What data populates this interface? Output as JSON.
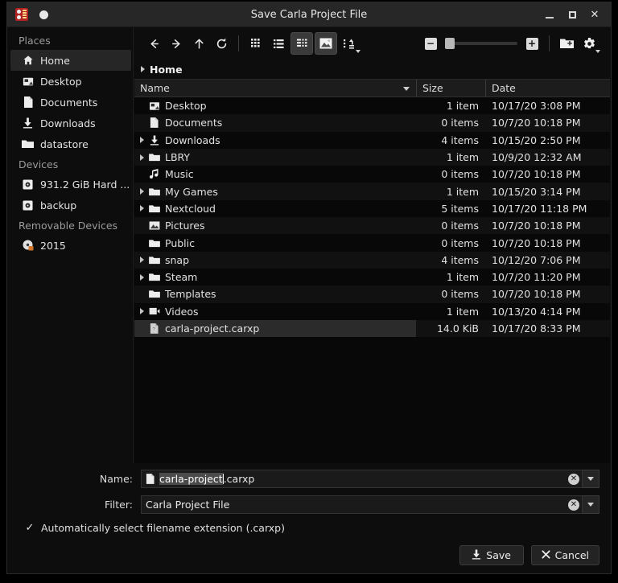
{
  "window": {
    "title": "Save Carla Project File",
    "app_icon": "carla-logo-icon",
    "minimize_label": "",
    "maximize_label": "",
    "close_label": "✕"
  },
  "sidebar": {
    "sections": [
      {
        "heading": "Places",
        "items": [
          {
            "label": "Home",
            "icon": "home-icon",
            "selected": true
          },
          {
            "label": "Desktop",
            "icon": "desktop-icon",
            "selected": false
          },
          {
            "label": "Documents",
            "icon": "document-icon",
            "selected": false
          },
          {
            "label": "Downloads",
            "icon": "download-icon",
            "selected": false
          },
          {
            "label": "datastore",
            "icon": "folder-icon",
            "selected": false
          }
        ]
      },
      {
        "heading": "Devices",
        "items": [
          {
            "label": "931.2 GiB Hard ...",
            "icon": "harddisk-icon",
            "selected": false
          },
          {
            "label": "backup",
            "icon": "harddisk-icon",
            "selected": false
          }
        ]
      },
      {
        "heading": "Removable Devices",
        "items": [
          {
            "label": "2015",
            "icon": "optical-disc-icon",
            "selected": false
          }
        ]
      }
    ]
  },
  "toolbar": {
    "back": "back-icon",
    "forward": "forward-icon",
    "up": "up-icon",
    "reload": "reload-icon",
    "icon_view": "icon-view-icon",
    "list_view": "list-view-icon",
    "detail_view": "detail-view-icon",
    "preview": "preview-icon",
    "sort": "sort-icon",
    "zoom_out": "zoom-out-icon",
    "zoom_in": "zoom-in-icon",
    "new_folder": "new-folder-icon",
    "options": "gear-icon"
  },
  "breadcrumb": {
    "path": "Home"
  },
  "filelist": {
    "columns": [
      "Name",
      "Size",
      "Date"
    ],
    "sort_column": "Name",
    "rows": [
      {
        "name": "Desktop",
        "size": "1 item",
        "date": "10/17/20 3:08 PM",
        "icon": "desktop-icon",
        "expandable": false,
        "selected": false
      },
      {
        "name": "Documents",
        "size": "0 items",
        "date": "10/7/20 10:18 PM",
        "icon": "document-icon",
        "expandable": false,
        "selected": false
      },
      {
        "name": "Downloads",
        "size": "4 items",
        "date": "10/15/20 2:50 PM",
        "icon": "download-icon",
        "expandable": true,
        "selected": false
      },
      {
        "name": "LBRY",
        "size": "1 item",
        "date": "10/9/20 12:32 AM",
        "icon": "folder-icon",
        "expandable": true,
        "selected": false
      },
      {
        "name": "Music",
        "size": "0 items",
        "date": "10/7/20 10:18 PM",
        "icon": "music-icon",
        "expandable": false,
        "selected": false
      },
      {
        "name": "My Games",
        "size": "1 item",
        "date": "10/15/20 3:14 PM",
        "icon": "folder-icon",
        "expandable": true,
        "selected": false
      },
      {
        "name": "Nextcloud",
        "size": "5 items",
        "date": "10/17/20 11:18 PM",
        "icon": "folder-icon",
        "expandable": true,
        "selected": false
      },
      {
        "name": "Pictures",
        "size": "0 items",
        "date": "10/7/20 10:18 PM",
        "icon": "pictures-icon",
        "expandable": false,
        "selected": false
      },
      {
        "name": "Public",
        "size": "0 items",
        "date": "10/7/20 10:18 PM",
        "icon": "folder-icon",
        "expandable": false,
        "selected": false
      },
      {
        "name": "snap",
        "size": "4 items",
        "date": "10/12/20 7:06 PM",
        "icon": "folder-icon",
        "expandable": true,
        "selected": false
      },
      {
        "name": "Steam",
        "size": "1 item",
        "date": "10/7/20 11:20 PM",
        "icon": "folder-icon",
        "expandable": true,
        "selected": false
      },
      {
        "name": "Templates",
        "size": "0 items",
        "date": "10/7/20 10:18 PM",
        "icon": "folder-icon",
        "expandable": false,
        "selected": false
      },
      {
        "name": "Videos",
        "size": "1 item",
        "date": "10/13/20 4:14 PM",
        "icon": "videos-icon",
        "expandable": true,
        "selected": false
      },
      {
        "name": "carla-project.carxp",
        "size": "14.0 KiB",
        "date": "10/17/20 8:33 PM",
        "icon": "file-icon",
        "expandable": false,
        "selected": true
      }
    ]
  },
  "footer": {
    "name_label": "Name:",
    "name_value_selected": "carla-project",
    "name_value_rest": ".carxp",
    "name_icon": "document-icon",
    "name_clear": "✕",
    "filter_label": "Filter:",
    "filter_value": "Carla Project File",
    "filter_clear": "✕",
    "autoext_label": "Automatically select filename extension (.carxp)",
    "autoext_checked": "✓",
    "save_label": "Save",
    "save_icon": "save-download-icon",
    "cancel_label": "Cancel",
    "cancel_icon": "close-x-icon"
  },
  "colors": {
    "window_bg": "#0d0d0d",
    "titlebar": "#272727",
    "selection": "#2b2b2b",
    "text": "#e1e1e1",
    "accent": "#b22222"
  }
}
